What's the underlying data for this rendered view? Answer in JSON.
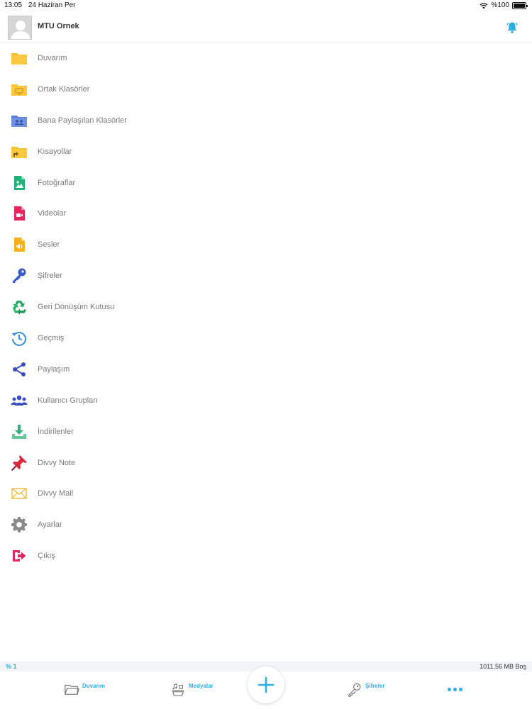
{
  "status_bar": {
    "time": "13:05",
    "date": "24 Haziran Per",
    "battery": "%100"
  },
  "header": {
    "user_name": "MTU Ornek",
    "avatar_icon": "avatar-placeholder-icon",
    "notification_icon": "bell-icon"
  },
  "menu": {
    "items": [
      {
        "label": "Duvarım",
        "icon": "folder-icon"
      },
      {
        "label": "Ortak Klasörler",
        "icon": "shared-folder-icon"
      },
      {
        "label": "Bana Paylaşılan Klasörler",
        "icon": "shared-with-me-folder-icon"
      },
      {
        "label": "Kısayollar",
        "icon": "shortcut-folder-icon"
      },
      {
        "label": "Fotoğraflar",
        "icon": "photo-file-icon"
      },
      {
        "label": "Videolar",
        "icon": "video-file-icon"
      },
      {
        "label": "Sesler",
        "icon": "audio-file-icon"
      },
      {
        "label": "Şifreler",
        "icon": "key-icon"
      },
      {
        "label": "Geri Dönüşüm Kutusu",
        "icon": "recycle-icon"
      },
      {
        "label": "Geçmiş",
        "icon": "history-icon"
      },
      {
        "label": "Paylaşım",
        "icon": "share-icon"
      },
      {
        "label": "Kullanıcı Grupları",
        "icon": "user-groups-icon"
      },
      {
        "label": "İndirilenler",
        "icon": "download-icon"
      },
      {
        "label": "Divvy Note",
        "icon": "pin-icon"
      },
      {
        "label": "Divvy Mail",
        "icon": "mail-icon"
      },
      {
        "label": "Ayarlar",
        "icon": "gear-icon"
      },
      {
        "label": "Çıkış",
        "icon": "logout-icon"
      }
    ]
  },
  "storage": {
    "used_percent": "% 1",
    "free": "1011,56 MB Boş"
  },
  "tab_bar": {
    "duvarim": "Duvarım",
    "medyalar": "Medyalar",
    "sifreler": "Şifreler",
    "add_icon": "plus-icon",
    "more_icon": "more-dots-icon"
  },
  "colors": {
    "accent": "#2ab0e3",
    "folder": "#f9bf2c",
    "text": "#7a7a7a"
  }
}
